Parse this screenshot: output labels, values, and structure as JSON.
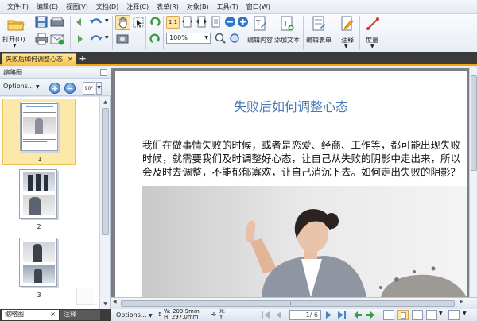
{
  "menu": [
    "文件(F)",
    "编辑(E)",
    "视图(V)",
    "文档(D)",
    "注释(C)",
    "表单(R)",
    "对象(B)",
    "工具(T)",
    "窗口(W)"
  ],
  "toolbar": {
    "open_label": "打开(O)...",
    "zoom_value": "100%",
    "edit_content_label": "编辑内容",
    "add_text_label": "添加文本",
    "edit_form_label": "编辑表单",
    "annotate_label": "注释",
    "measure_label": "度量"
  },
  "tab": {
    "title": "失败后如何调整心态",
    "close": "×",
    "add": "+"
  },
  "panel": {
    "title": "缩略图",
    "options": "Options...",
    "zoom_in": "+",
    "zoom_out": "−",
    "rotate": "90°",
    "thumbnails": [
      {
        "num": "1"
      },
      {
        "num": "2"
      },
      {
        "num": "3"
      }
    ],
    "bottom_tabs": {
      "thumbnails": "缩略图",
      "thumbnails_close": "×",
      "annotations": "注释"
    }
  },
  "document": {
    "title": "失败后如何调整心态",
    "paragraph_lines": [
      "我们在做事情失败的时候，或者是恋爱、经商、工作等，都可能出现失败",
      "时候，就需要我们及时调整好心态，让自己从失败的阴影中走出来，所以",
      "会及时去调整，不能郁郁寡欢，让自己消沉下去。如何走出失败的阴影？"
    ]
  },
  "status": {
    "options": "Options...",
    "width": "W: 209.9mm",
    "height": "H: 297.0mm",
    "x": "X:",
    "y": "Y:",
    "page_current": "1",
    "page_total": "/ 6"
  },
  "colors": {
    "accent": "#f2a60b",
    "title_blue": "#4a7ab3",
    "tab_bg": "#3b3b3b"
  }
}
